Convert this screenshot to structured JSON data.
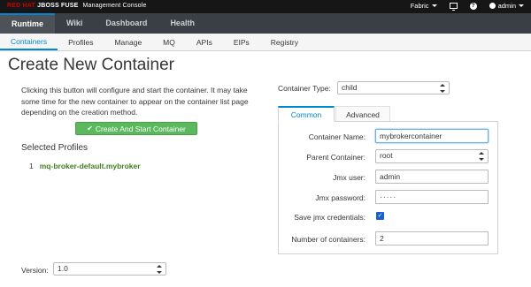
{
  "header": {
    "brand_red": "RED HAT",
    "brand_white": " JBOSS FUSE",
    "brand_console": "Management Console",
    "fabric_label": "Fabric",
    "user_label": "admin"
  },
  "main_nav": [
    "Runtime",
    "Wiki",
    "Dashboard",
    "Health"
  ],
  "sub_nav": [
    "Containers",
    "Profiles",
    "Manage",
    "MQ",
    "APIs",
    "EIPs",
    "Registry"
  ],
  "page": {
    "title": "Create New Container",
    "description": "Clicking this button will configure and start the container. It may take some time for the new container to appear on the container list page depending on the creation method.",
    "create_button": "Create And Start Container",
    "selected_profiles_heading": "Selected Profiles",
    "profiles": [
      {
        "num": "1",
        "name": "mq-broker-default.mybroker"
      }
    ],
    "version_label": "Version:",
    "version_value": "1.0"
  },
  "form": {
    "container_type_label": "Container Type:",
    "container_type_value": "child",
    "tabs": [
      "Common",
      "Advanced"
    ],
    "container_name_label": "Container Name:",
    "container_name_value": "mybrokercontainer",
    "parent_container_label": "Parent Container:",
    "parent_container_value": "root",
    "jmx_user_label": "Jmx user:",
    "jmx_user_value": "admin",
    "jmx_password_label": "Jmx password:",
    "jmx_password_value": "·····",
    "save_jmx_label": "Save jmx credentials:",
    "save_jmx_checked": true,
    "num_containers_label": "Number of containers:",
    "num_containers_value": "2"
  },
  "colors": {
    "brand_red": "#cc0000",
    "accent_blue": "#0088ce",
    "button_green": "#5cb85c",
    "profile_link_green": "#3f7e1f",
    "header_bg": "#161616",
    "nav_bg": "#393f44"
  },
  "icons": [
    "caret-down-icon",
    "monitor-icon",
    "help-icon",
    "user-icon",
    "check-icon",
    "updown-select-icon"
  ]
}
